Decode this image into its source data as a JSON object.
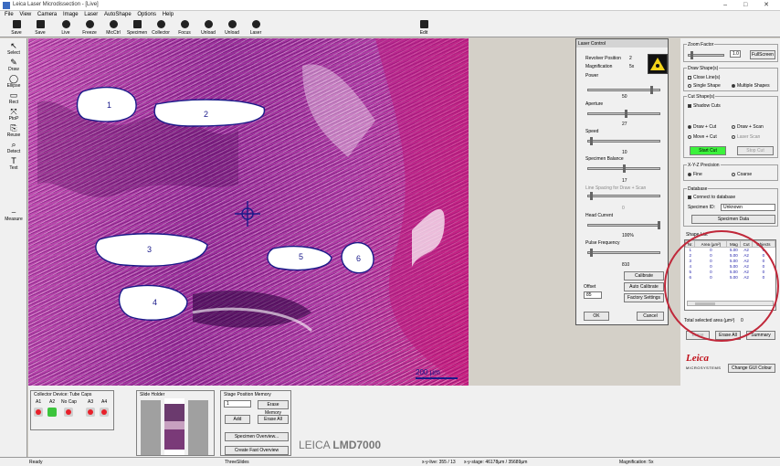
{
  "window": {
    "title": "Leica Laser Microdissection - [Live]",
    "controls": [
      "–",
      "□",
      "✕"
    ]
  },
  "menu": [
    "File",
    "View",
    "Camera",
    "Image",
    "Laser",
    "AutoShape",
    "Options",
    "Help"
  ],
  "toolbar": [
    {
      "label": "Save",
      "icon": "save-icon"
    },
    {
      "label": "Save",
      "icon": "save-as-icon"
    },
    {
      "label": "Live",
      "icon": "live-icon"
    },
    {
      "label": "Freeze",
      "icon": "freeze-icon"
    },
    {
      "label": "MicCtrl",
      "icon": "microscope-control-icon"
    },
    {
      "label": "Specimen",
      "icon": "specimen-icon"
    },
    {
      "label": "Collector",
      "icon": "collector-icon"
    },
    {
      "label": "Focus",
      "icon": "focus-icon"
    },
    {
      "label": "Unload",
      "icon": "unload-icon"
    },
    {
      "label": "Unload",
      "icon": "unload-2-icon"
    },
    {
      "label": "Laser",
      "icon": "laser-icon"
    },
    {
      "label": "Edit",
      "icon": "edit-icon"
    }
  ],
  "lefttools": [
    {
      "label": "Select",
      "glyph": "↖"
    },
    {
      "label": "Draw",
      "glyph": "✎"
    },
    {
      "label": "Ellipse",
      "glyph": "◯"
    },
    {
      "label": "Rect",
      "glyph": "▭"
    },
    {
      "label": "PtoP",
      "glyph": "⤧"
    },
    {
      "label": "Reuse",
      "glyph": "⎘"
    },
    {
      "label": "Detect",
      "glyph": "⌕"
    },
    {
      "label": "Text",
      "glyph": "T"
    },
    {
      "label": "Measure",
      "glyph": "⎯"
    }
  ],
  "shapes": [
    "1",
    "2",
    "3",
    "4",
    "5",
    "6"
  ],
  "image_scale": "200 µm",
  "collector": {
    "title": "Collector Device: Tube Caps",
    "slots": [
      {
        "label": "A1",
        "color": "#e8202a"
      },
      {
        "label": "A2",
        "color": "#3cc43c"
      },
      {
        "label": "No Cap",
        "color": "#e8202a"
      },
      {
        "label": "A3",
        "color": "#e8202a"
      },
      {
        "label": "A4",
        "color": "#e8202a"
      }
    ]
  },
  "slide_holder": {
    "title": "Slide Holder"
  },
  "stage_memory": {
    "title": "Stage Position Memory",
    "select": "1",
    "erase_memory": "Erase Memory",
    "add": "Add",
    "erase_all": "Erase All",
    "specimen_overview": "Specimen Overview...",
    "create_fast_overview": "Create Fast Overview"
  },
  "brand": {
    "leica": "LEICA",
    "model": "LMD7000"
  },
  "laser_control": {
    "title": "Laser Control",
    "revolver_label": "Revolver Position",
    "revolver_value": "2",
    "magnification_label": "Magnification",
    "magnification_value": "5x",
    "power_label": "Power",
    "power_value": "50",
    "aperture_label": "Aperture",
    "aperture_value": "27",
    "speed_label": "Speed",
    "speed_value": "10",
    "balance_label": "Specimen Balance",
    "balance_value": "17",
    "line_label": "Line Spacing for Draw + Scan",
    "line_value": "0",
    "head_label": "Head Current",
    "head_value": "100%",
    "pulse_label": "Pulse Frequency",
    "pulse_value": "810",
    "offset_label": "Offset",
    "offset_value": "85",
    "calibrate": "Calibrate",
    "auto_calibrate": "Auto Calibrate",
    "factory": "Factory Settings",
    "ok": "OK",
    "cancel": "Cancel"
  },
  "right_panel": {
    "zoom_title": "Zoom Factor",
    "zoom_value": "1.0",
    "fullscreen": "FullScreen",
    "draw_title": "Draw Shape(s)",
    "close_line": "Close Line(s)",
    "single": "Single Shape",
    "multiple": "Multiple Shapes",
    "cut_title": "Cut Shape(s)",
    "shadow": "Shadow Cuts",
    "draw_cut": "Draw + Cut",
    "draw_scan": "Draw + Scan",
    "move_cut": "Move + Cut",
    "laser_scan": "Laser Scan",
    "start_cut": "Start Cut",
    "stop_cut": "Stop Cut",
    "precision_title": "X-Y-Z Precision",
    "fine": "Fine",
    "coarse": "Coarse",
    "database_title": "Database",
    "connect": "Connect to database",
    "specimen_id_label": "Specimen ID:",
    "specimen_id": "Unknown",
    "specimen_data": "Specimen Data",
    "shape_list_title": "Shape List",
    "columns": [
      "Nr.",
      "Area (µm²)",
      "Mag",
      "Cut",
      "Objects"
    ],
    "rows": [
      [
        "1",
        "0",
        "5.00",
        "A2",
        "0"
      ],
      [
        "2",
        "0",
        "5.00",
        "A2",
        "0"
      ],
      [
        "3",
        "0",
        "5.00",
        "A2",
        "0"
      ],
      [
        "4",
        "0",
        "5.00",
        "A2",
        "0"
      ],
      [
        "5",
        "0",
        "5.00",
        "A2",
        "0"
      ],
      [
        "6",
        "0",
        "5.00",
        "A2",
        "0"
      ]
    ],
    "total_label": "Total selected area (µm²)",
    "total_value": "0",
    "erase": "Erase",
    "erase_all": "Erase All",
    "summary": "Summary",
    "logo": "Leica",
    "logo_sub": "MICROSYSTEMS",
    "change_gui": "Change GUI Colour"
  },
  "status": {
    "ready": "Ready",
    "mode": "ThreeSlides",
    "xy_live": "x-y-live: 355 / 13",
    "xy_stage": "x-y-stage: 46178µm / 35689µm",
    "magnification": "Magnification: 5x"
  },
  "colors": {
    "shape_outline": "#1a1a8a",
    "start_cut": "#3cf23c",
    "annotation": "#c0283a"
  }
}
